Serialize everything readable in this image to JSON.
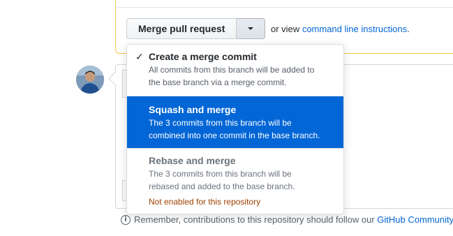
{
  "merge": {
    "button_label": "Merge pull request",
    "or_view": "or view",
    "cli_link": "command line instructions",
    "period": "."
  },
  "menu": {
    "items": [
      {
        "title": "Create a merge commit",
        "desc1": "All commits from this branch will be added to",
        "desc2": "the base branch via a merge commit.",
        "checked": true
      },
      {
        "title": "Squash and merge",
        "desc1": "The 3 commits from this branch will be",
        "desc2": "combined into one commit in the base branch.",
        "selected": true
      },
      {
        "title": "Rebase and merge",
        "desc1": "The 3 commits from this branch will be",
        "desc2": "rebased and added to the base branch.",
        "warning": "Not enabled for this repository",
        "disabled": true
      }
    ],
    "check_icon": "check-icon"
  },
  "footer": {
    "text": "Remember, contributions to this repository should follow our",
    "link": "GitHub Community"
  },
  "colors": {
    "accent": "#0366d6",
    "warning": "#a04100"
  }
}
